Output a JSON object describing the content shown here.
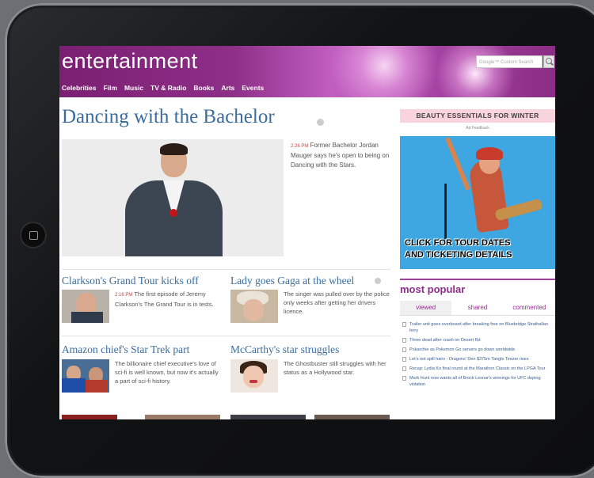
{
  "header": {
    "logo": "entertainment",
    "search_placeholder": "Google™ Custom Search",
    "nav": [
      "Celebrities",
      "Film",
      "Music",
      "TV & Radio",
      "Books",
      "Arts",
      "Events"
    ]
  },
  "lead": {
    "headline": "Dancing with the Bachelor",
    "time": "2:26 PM",
    "summary": "Former Bachelor Jordan Mauger says he's open to being on Dancing with the Stars."
  },
  "stories": [
    {
      "title": "Clarkson's Grand Tour kicks off",
      "time": "2:16 PM",
      "text": "The first episode of Jeremy Clarkson's The Grand Tour is in tests."
    },
    {
      "title": "Lady goes Gaga at the wheel",
      "time": "",
      "text": "The singer was pulled over by the police only weeks after getting her drivers licence."
    },
    {
      "title": "Amazon chief's Star Trek part",
      "time": "",
      "text": "The billionaire chief executive's love of sci-fi is well known, but now it's actually a part of sci-fi history."
    },
    {
      "title": "McCarthy's star struggles",
      "time": "",
      "text": "The Ghostbuster still struggles with her status as a Hollywood star."
    }
  ],
  "ad": {
    "heading": "BEAUTY ESSENTIALS FOR WINTER",
    "feedback": "Ad Feedback",
    "cta_line1": "CLICK FOR TOUR DATES",
    "cta_line2": "AND TICKETING DETAILS"
  },
  "popular": {
    "title": "most popular",
    "tabs": [
      "viewed",
      "shared",
      "commented"
    ],
    "items": [
      "Trailer unit goes overboard after breaking free on Bluebridge Strathallan ferry",
      "Three dead after crash on Desert Rd",
      "Pokarchie as Pokemon Go servers go down worldwide",
      "Let's not spill hairs - Dragons' Den $375m Tangle Teezer rises",
      "Recap: Lydia Ko final round at the Marathon Classic on the LPGA Tour",
      "Mark Hunt now wants all of Brock Lesnar's winnings for UFC doping violation"
    ]
  },
  "colors": {
    "header": "#8e2f88",
    "link": "#3a6d9e",
    "accent": "#8d2d8a",
    "time": "#d14242"
  }
}
